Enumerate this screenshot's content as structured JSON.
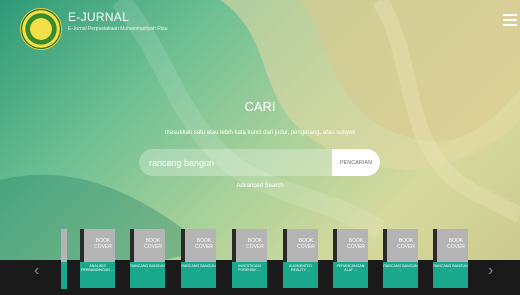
{
  "header": {
    "title": "E-JURNAL",
    "subtitle": "E-Jurnal Perpustakaan Muhammadiyah Riau",
    "logo_icon": "university-seal-logo",
    "menu_icon": "hamburger-menu-icon"
  },
  "search": {
    "heading": "CARI",
    "description": "masukkan satu atau lebih kata kunci dari judul, pengarang, atau subyek",
    "query": "rancang bangun",
    "button_label": "PENCARIAN",
    "advanced_link": "Advanced Search"
  },
  "carousel": {
    "prev_icon": "chevron-left-icon",
    "next_icon": "chevron-right-icon",
    "cover_text": "BOOK COVER",
    "items": [
      {
        "label": "ANALISIS PERBANDINGAN ..."
      },
      {
        "label": "RANCANG BANGUN ..."
      },
      {
        "label": "RANCANG BANGUN ..."
      },
      {
        "label": "INVESTIGASI FORENSIK ..."
      },
      {
        "label": "AUGMENTED REALITY ..."
      },
      {
        "label": "PERANCANGAN ALAT ..."
      },
      {
        "label": "RANCANG BANGUN ..."
      },
      {
        "label": "RANCANG BANGUN ..."
      }
    ]
  },
  "colors": {
    "accent": "#1aa88c",
    "strip": "#1a1a1a"
  }
}
